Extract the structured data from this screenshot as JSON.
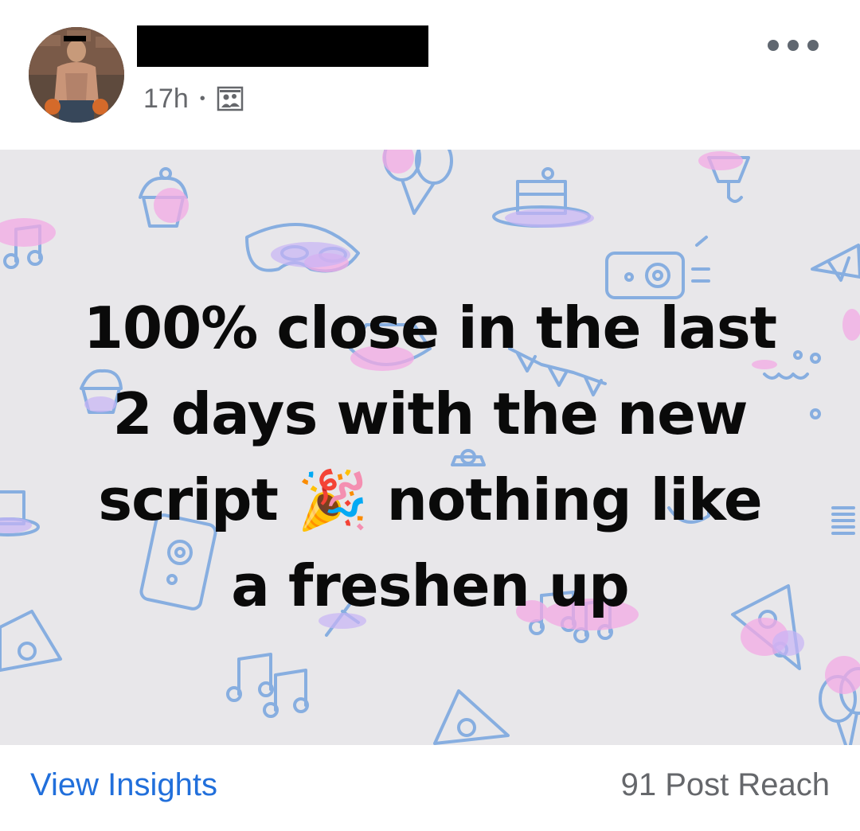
{
  "post": {
    "timestamp": "17h",
    "separator": "•",
    "audience_icon": "group-audience-icon",
    "more_icon": "more-options-icon",
    "image_text_lines": [
      "100% close in the last",
      "2 days with the new",
      "script 🎉 nothing like",
      "a freshen up"
    ]
  },
  "footer": {
    "view_insights_label": "View Insights",
    "reach_label": "91 Post Reach"
  },
  "colors": {
    "link": "#216fdb",
    "muted": "#65676b",
    "image_background": "#e8e7ea"
  }
}
